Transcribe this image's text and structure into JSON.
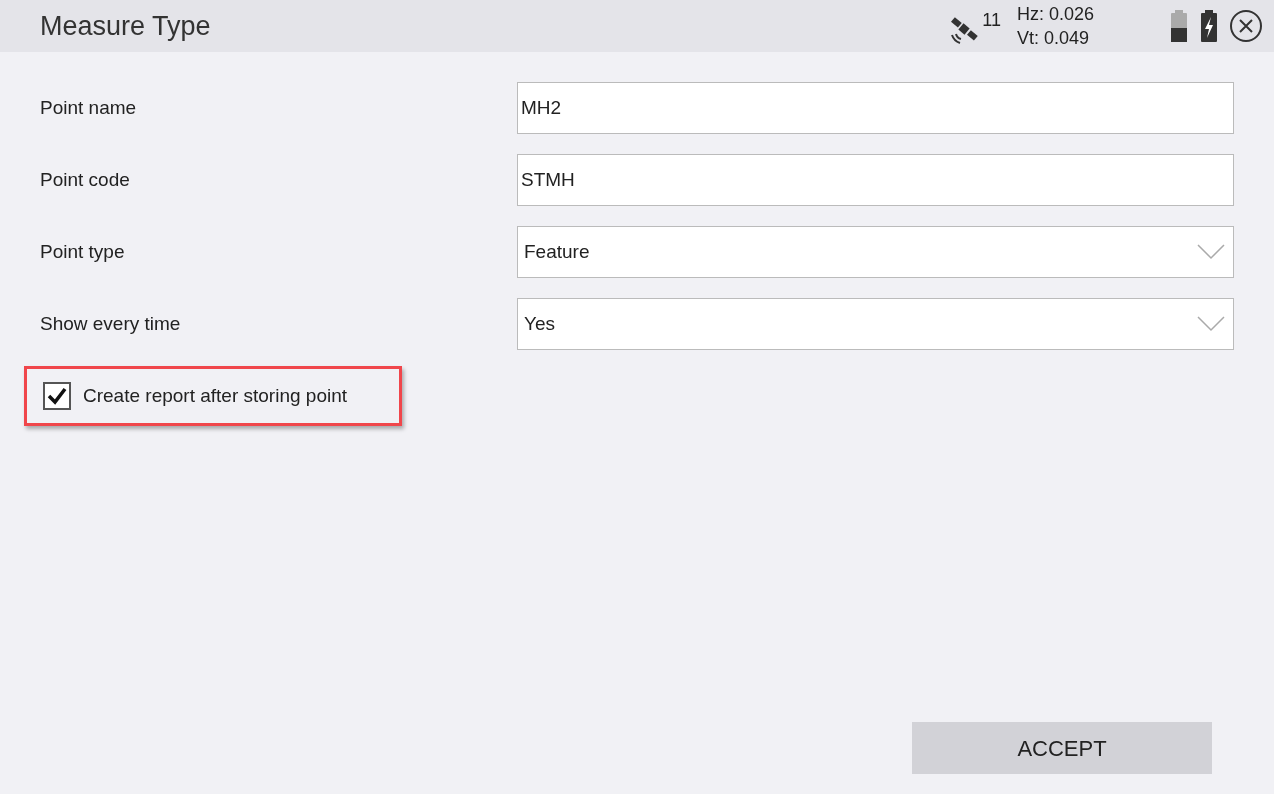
{
  "header": {
    "title": "Measure Type",
    "satellites": "11",
    "hz": "Hz: 0.026",
    "vt": "Vt: 0.049"
  },
  "fields": [
    {
      "label": "Point name",
      "kind": "text",
      "value": "MH2"
    },
    {
      "label": "Point code",
      "kind": "text",
      "value": "STMH"
    },
    {
      "label": "Point type",
      "kind": "dropdown",
      "value": "Feature"
    },
    {
      "label": "Show every time",
      "kind": "dropdown",
      "value": "Yes"
    }
  ],
  "checkbox": {
    "label": "Create report after storing point",
    "checked": true,
    "highlighted": true
  },
  "accept_button": "ACCEPT"
}
